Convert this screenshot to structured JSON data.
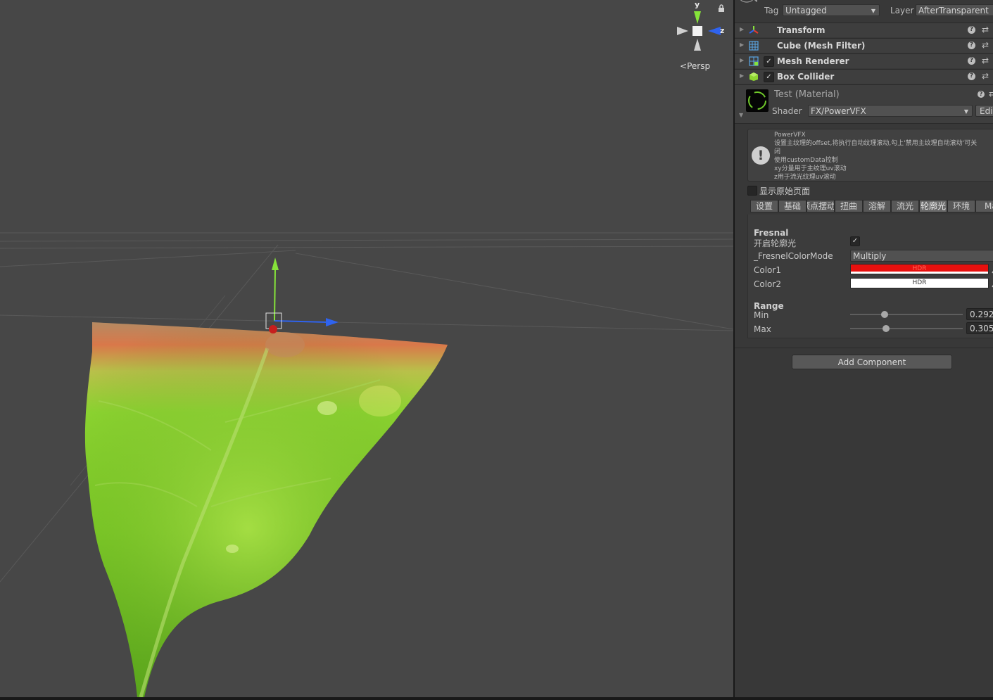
{
  "scene": {
    "gizmo_axes": {
      "y": "y",
      "z": "z"
    },
    "projection_label": "Persp",
    "lock_icon": "lock-icon"
  },
  "inspector": {
    "tag_label": "Tag",
    "tag_value": "Untagged",
    "layer_label": "Layer",
    "layer_value": "AfterTransparent",
    "components": [
      {
        "name": "Transform",
        "icon": "transform-icon",
        "has_checkbox": false
      },
      {
        "name": "Cube (Mesh Filter)",
        "icon": "mesh-filter-icon",
        "has_checkbox": false
      },
      {
        "name": "Mesh Renderer",
        "icon": "mesh-renderer-icon",
        "has_checkbox": true,
        "checked": true
      },
      {
        "name": "Box Collider",
        "icon": "box-collider-icon",
        "has_checkbox": true,
        "checked": true
      }
    ],
    "material": {
      "title": "Test (Material)",
      "shader_label": "Shader",
      "shader_value": "FX/PowerVFX",
      "edit_label": "Edi"
    },
    "help_box": [
      "PowerVFX",
      "设置主纹理的offset,将执行自动纹理滚动,勾上'禁用主纹理自动滚动'可关",
      "闭",
      "使用customData控制",
      "xy分量用于主纹理uv滚动",
      "z用于流光纹理uv滚动"
    ],
    "show_raw_page_label": "显示原始页面",
    "tabs": [
      "设置",
      "基础",
      "顶点摆动",
      "扭曲",
      "溶解",
      "流光",
      "轮廓光",
      "环境",
      "MatCap"
    ],
    "active_tab": "轮廓光",
    "fresnel": {
      "section": "Fresnal",
      "enable_label": "开启轮廓光",
      "enable_checked": true,
      "color_mode_label": "_FresnelColorMode",
      "color_mode_value": "Multiply",
      "color1_label": "Color1",
      "color1_value": "#e8100e",
      "color1_hdr": "HDR",
      "color2_label": "Color2",
      "color2_value": "#ffffff",
      "color2_hdr": "HDR",
      "range_label": "Range",
      "min_label": "Min",
      "min_value": "0.292",
      "max_label": "Max",
      "max_value": "0.305"
    },
    "add_component_label": "Add Component"
  },
  "colors": {
    "scene_bg": "#474747",
    "inspector_bg": "#383838",
    "y_axis": "#86e33a",
    "x_axis": "#e83b2f",
    "z_axis": "#2f63ee"
  }
}
